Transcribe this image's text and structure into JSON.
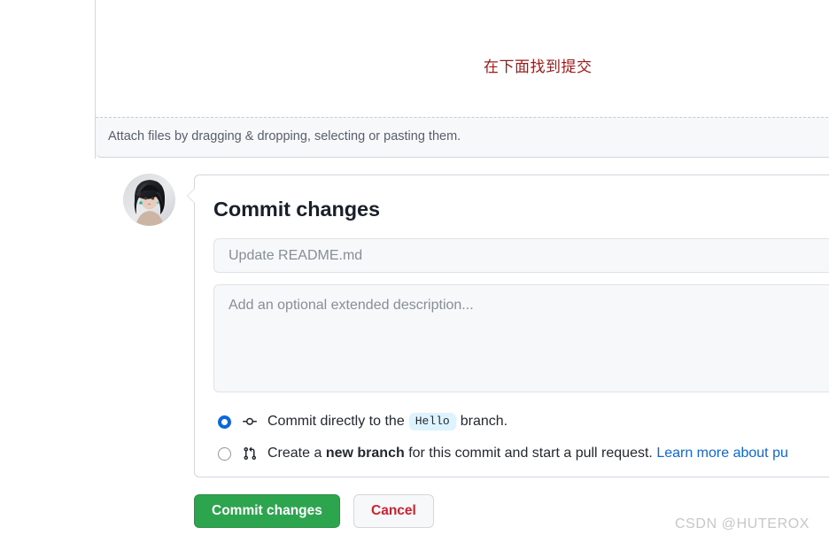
{
  "editor": {
    "annotation_note": "在下面找到提交",
    "annotation_color": "#9e1a1a",
    "attach_files_text": "Attach files by dragging & dropping, selecting or pasting them."
  },
  "commit_form": {
    "title": "Commit changes",
    "summary_placeholder": "Update README.md",
    "summary_value": "",
    "description_placeholder": "Add an optional extended description...",
    "description_value": "",
    "options": [
      {
        "id": "commit-directly",
        "selected": true,
        "icon": "git-commit-icon",
        "text_before": "Commit directly to the",
        "branch_name": "Hello",
        "text_after": "branch."
      },
      {
        "id": "create-new-branch",
        "selected": false,
        "icon": "git-pull-request-icon",
        "text_before": "Create a",
        "emphasis": "new branch",
        "text_middle": "for this commit and start a pull request.",
        "link_text": "Learn more about pu"
      }
    ],
    "submit_label": "Commit changes",
    "cancel_label": "Cancel",
    "accent_green": "#2da44e",
    "accent_red": "#cf222e",
    "accent_blue": "#0969da"
  },
  "avatar": {
    "alt": "user-avatar"
  },
  "watermark": {
    "text": "CSDN @HUTEROX"
  }
}
